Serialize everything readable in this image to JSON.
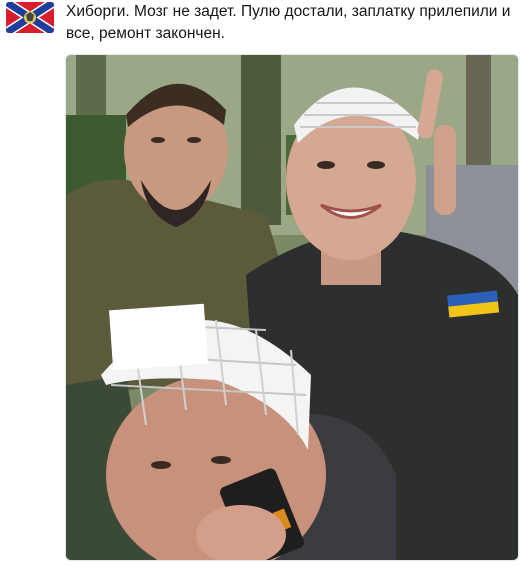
{
  "tweet": {
    "text": "Хиборги. Мозг не задет. Пулю достали, заплатку прилепили и все, ремонт закончен.",
    "avatar_icon": "novorossiya-flag-icon",
    "photo_icon": "selfie-photo"
  },
  "colors": {
    "flag_red": "#d81e2c",
    "flag_blue": "#1f3d9b",
    "text": "#14171a",
    "media_border": "#e1e8ed"
  }
}
